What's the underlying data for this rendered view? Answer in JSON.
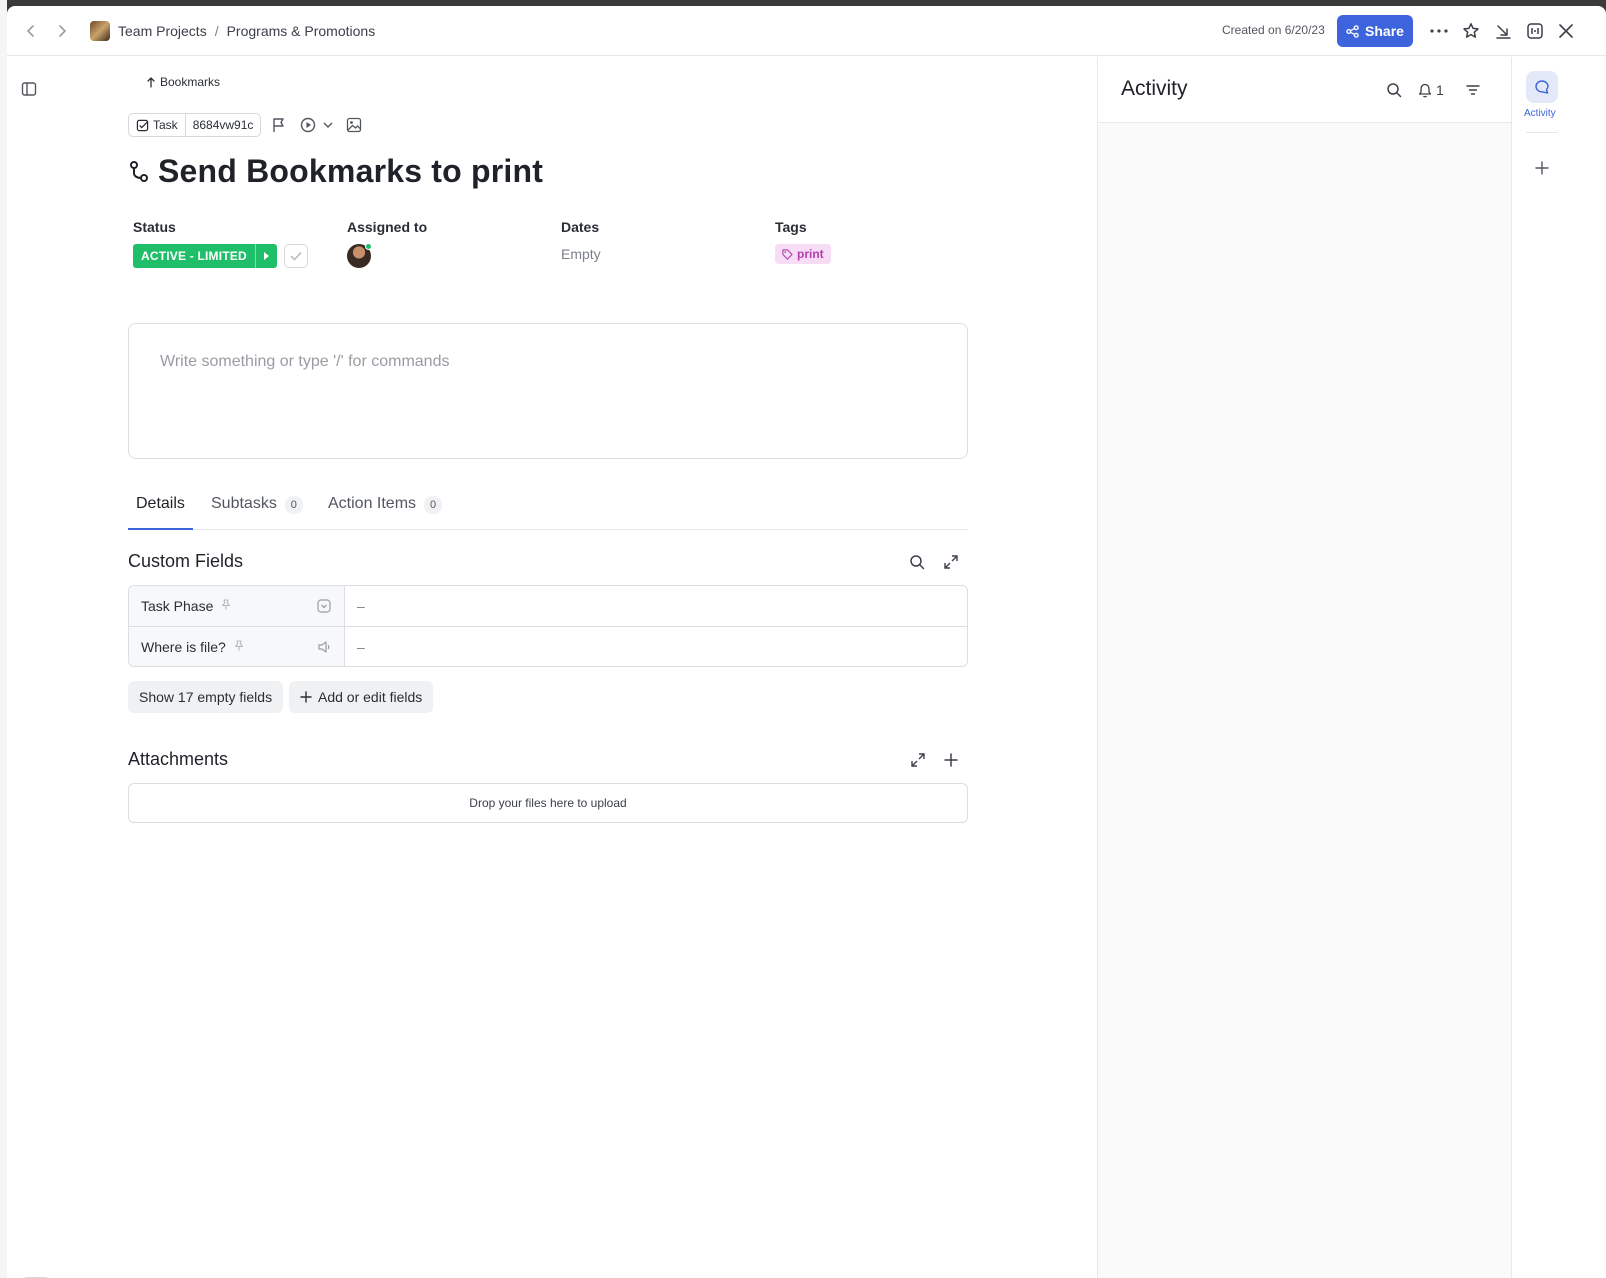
{
  "breadcrumb": {
    "space": "Team Projects",
    "separator": "/",
    "list": "Programs & Promotions"
  },
  "header": {
    "created": "Created on 6/20/23",
    "share_label": "Share"
  },
  "task": {
    "parent": "Bookmarks",
    "type": "Task",
    "id": "8684vw91c",
    "title": "Send Bookmarks to print"
  },
  "fields": {
    "status_label": "Status",
    "status_value": "ACTIVE - LIMITED",
    "assigned_label": "Assigned to",
    "dates_label": "Dates",
    "dates_value": "Empty",
    "tags_label": "Tags",
    "tag_value": "print"
  },
  "editor": {
    "placeholder": "Write something or type '/' for commands"
  },
  "tabs": [
    {
      "label": "Details"
    },
    {
      "label": "Subtasks",
      "count": "0"
    },
    {
      "label": "Action Items",
      "count": "0"
    }
  ],
  "custom_fields": {
    "title": "Custom Fields",
    "rows": [
      {
        "name": "Task Phase",
        "value": "–"
      },
      {
        "name": "Where is file?",
        "value": "–"
      }
    ],
    "show_empty": "Show 17 empty fields",
    "add_edit": "Add or edit fields"
  },
  "attachments": {
    "title": "Attachments",
    "dropzone": "Drop your files here to upload"
  },
  "activity": {
    "title": "Activity",
    "notification_count": "1",
    "rail_label": "Activity"
  },
  "colors": {
    "accent": "#3d64dc",
    "status": "#1fbf6a",
    "tag_bg": "#f6dcf4",
    "tag_text": "#b33fab"
  }
}
